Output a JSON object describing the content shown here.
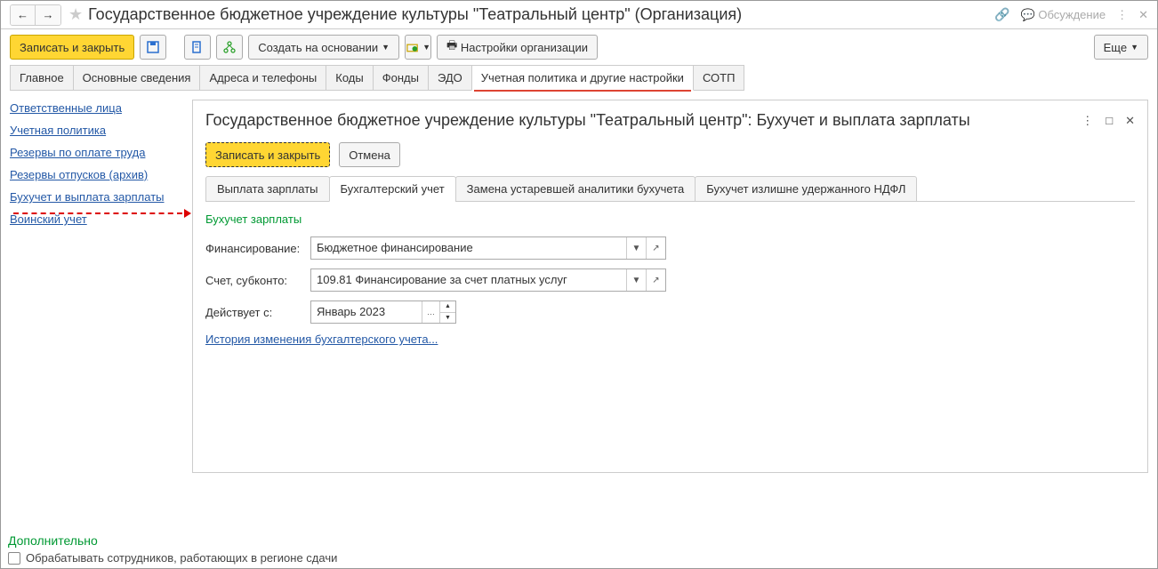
{
  "title": "Государственное бюджетное учреждение культуры \"Театральный центр\" (Организация)",
  "discussion": "Обсуждение",
  "toolbar": {
    "save_close": "Записать и закрыть",
    "create_based": "Создать на основании",
    "org_settings": "Настройки организации",
    "more": "Еще"
  },
  "main_tabs": [
    "Главное",
    "Основные сведения",
    "Адреса и телефоны",
    "Коды",
    "Фонды",
    "ЭДО",
    "Учетная политика и другие настройки",
    "СОТП"
  ],
  "sidebar": [
    "Ответственные лица",
    "Учетная политика",
    "Резервы по оплате труда",
    "Резервы отпусков (архив)",
    "Бухучет и выплата зарплаты",
    "Воинский учет"
  ],
  "panel": {
    "title": "Государственное бюджетное учреждение культуры \"Театральный центр\": Бухучет и выплата зарплаты",
    "save_close": "Записать и закрыть",
    "cancel": "Отмена",
    "tabs": [
      "Выплата зарплаты",
      "Бухгалтерский учет",
      "Замена устаревшей аналитики бухучета",
      "Бухучет излишне удержанного НДФЛ"
    ],
    "section": "Бухучет зарплаты",
    "rows": {
      "financing_label": "Финансирование:",
      "financing_value": "Бюджетное финансирование",
      "account_label": "Счет, субконто:",
      "account_value": "109.81 Финансирование за счет платных услуг",
      "valid_from_label": "Действует с:",
      "valid_from_value": "Январь 2023"
    },
    "history_link": "История изменения бухгалтерского учета..."
  },
  "footer": {
    "title": "Дополнительно",
    "checkbox": "Обрабатывать сотрудников, работающих в регионе сдачи"
  }
}
